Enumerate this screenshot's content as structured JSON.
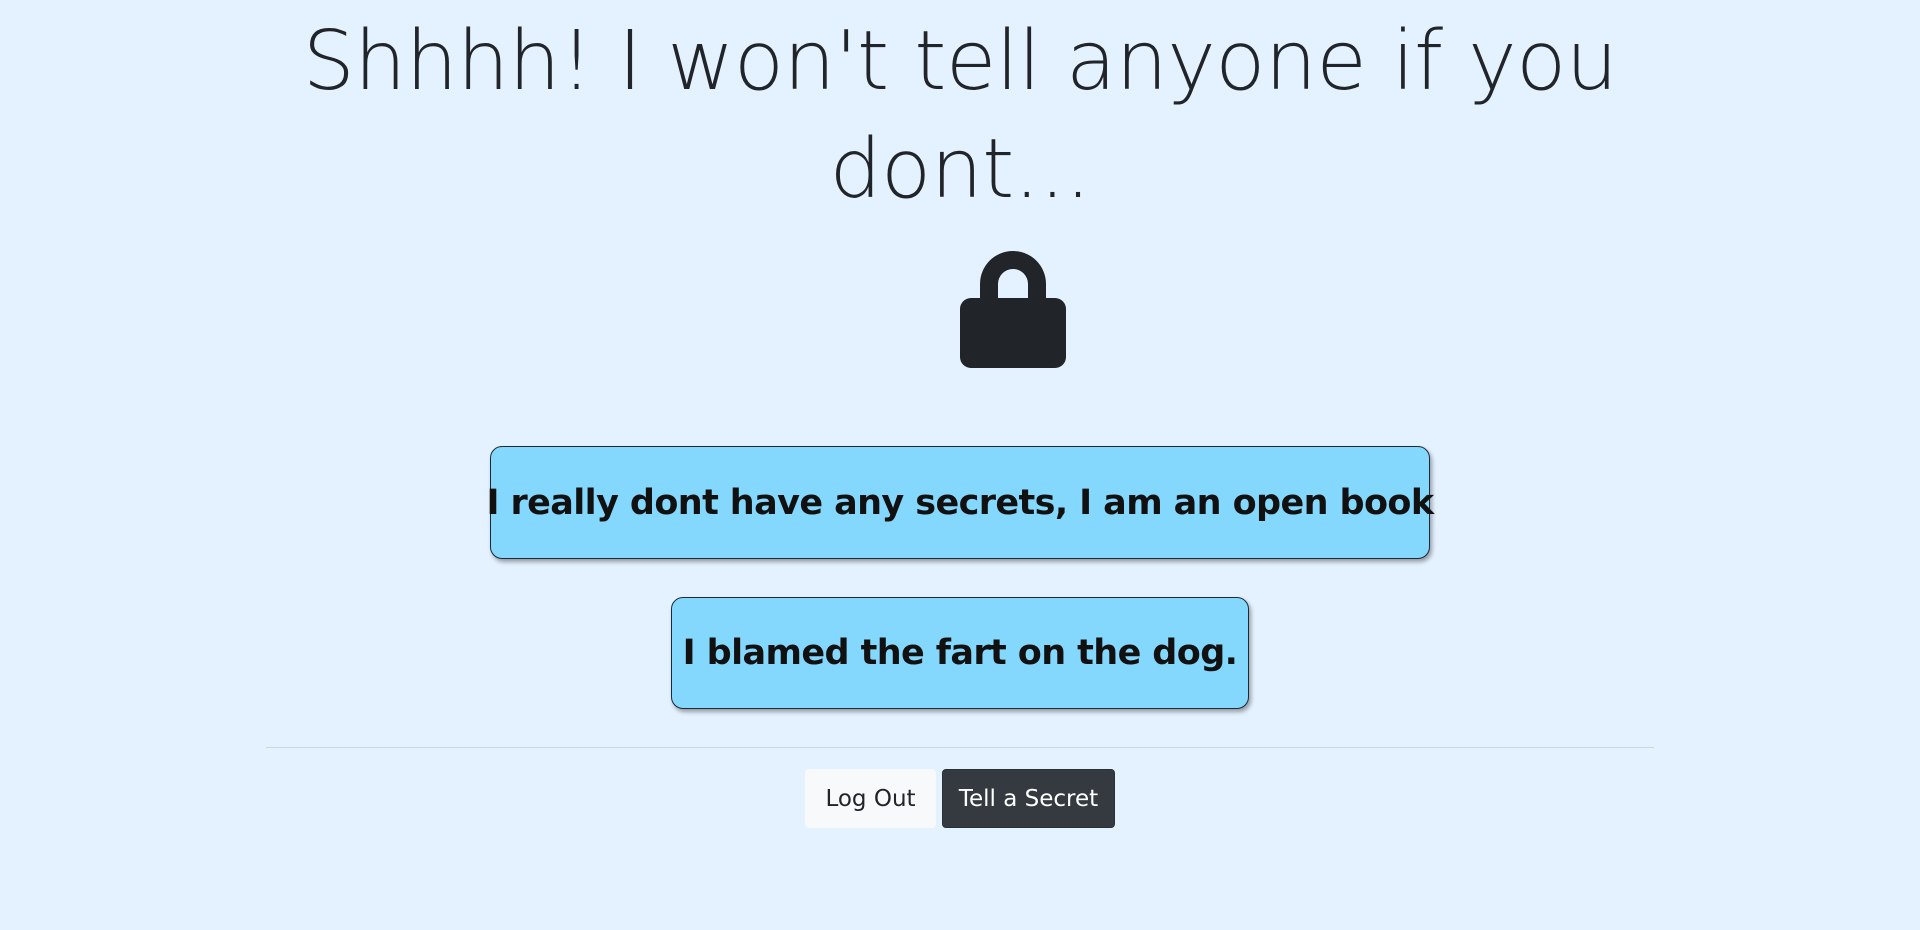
{
  "page": {
    "heading": "Shhhh! I won't tell anyone if you dont..."
  },
  "icons": {
    "hero": "lock-icon"
  },
  "secrets": [
    {
      "text": "I really dont have any secrets, I am an open book"
    },
    {
      "text": "I blamed the fart on the dog."
    }
  ],
  "buttons": {
    "logout_label": "Log Out",
    "tell_secret_label": "Tell a Secret"
  },
  "colors": {
    "background": "#e4f1ff",
    "card_background": "#84d8fd",
    "text": "#212529",
    "dark_button": "#343a40",
    "light_button": "#f8f9fa"
  }
}
